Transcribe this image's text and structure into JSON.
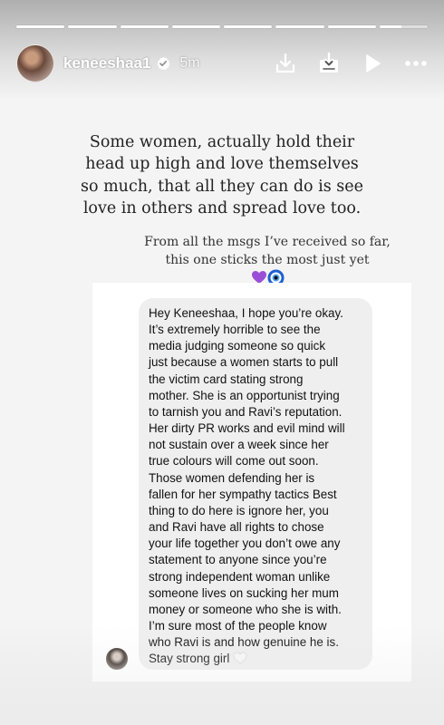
{
  "story": {
    "progress_segments": 8,
    "current_segment_fraction": 0.45
  },
  "header": {
    "username": "keneeshaa1",
    "time_ago": "5m",
    "verified": true,
    "actions": {
      "save": "download-icon",
      "add_to_story": "add-to-story-icon",
      "play": "play-icon",
      "more": "more-icon"
    }
  },
  "caption": {
    "main": "Some women, actually hold their\nhead up high and love themselves\nso much, that all they can do is see\nlove in others and spread love too.",
    "sub": "From all the msgs I’ve received so far,\nthis one sticks the most just yet",
    "emojis": [
      "purple-heart",
      "nazar-amulet"
    ]
  },
  "message": {
    "text": "Hey Keneeshaa, I hope you’re okay.\nIt’s extremely horrible to see the\nmedia judging someone so quick\njust because a women starts to pull\nthe victim card stating strong\nmother. She is an opportunist trying\nto tarnish you and Ravi’s reputation.\nHer dirty PR works and evil mind will\nnot sustain over a week since her\ntrue colours will come out soon.\nThose women defending her is\nfallen for her sympathy tactics Best\nthing to do here is ignore her, you\nand Ravi have all rights to chose\nyour life together you don’t owe any\nstatement to anyone since you’re\nstrong independent woman unlike\nsomeone lives on sucking her mum\nmoney or someone who she is with.\nI’m sure most of the people know\nwho Ravi is and how genuine he is.\nStay strong girl",
    "trailing_emoji": "white-heart"
  },
  "colors": {
    "accent_purple": "#9b4fd6",
    "nazar_blue": "#1f5fd1",
    "bubble_bg": "#efefef"
  }
}
